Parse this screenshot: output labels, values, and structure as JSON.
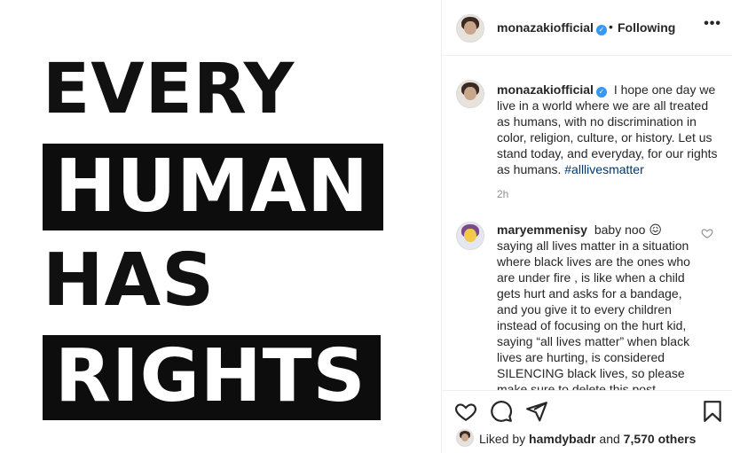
{
  "poster": {
    "line1": "EVERY",
    "line2": "HUMAN",
    "line3": "HAS",
    "line4": "RIGHTS"
  },
  "header": {
    "username": "monazakiofficial",
    "follow_separator": "•",
    "follow_label": "Following",
    "more_label": "•••"
  },
  "caption": {
    "username": "monazakiofficial",
    "text": "I hope one day we live in a world where we are all treated as humans, with no discrimination in color, religion, culture, or history. Let us stand today, and everyday, for our rights as humans.",
    "hashtag": "#alllivesmatter",
    "time": "2h"
  },
  "comment": {
    "username": "maryemmenisy",
    "text": "baby noo 😖 saying all lives matter in a situation where black lives are the ones who are under fire , is like when a child gets hurt and asks for a bandage, and you give it to every children instead of focusing on the hurt kid, saying “all lives matter” when black lives are hurting, is considered SILENCING black lives, so please make sure to delete this post"
  },
  "actions": {
    "like_icon": "heart-icon",
    "comment_icon": "comment-icon",
    "share_icon": "share-icon",
    "save_icon": "bookmark-icon"
  },
  "likes": {
    "prefix": "Liked by",
    "user": "hamdybadr",
    "middle": "and",
    "count": "7,570 others"
  },
  "colors": {
    "verified": "#3897f0",
    "hashtag": "#00376b",
    "muted": "#8e8e8e",
    "divider": "#efefef"
  }
}
